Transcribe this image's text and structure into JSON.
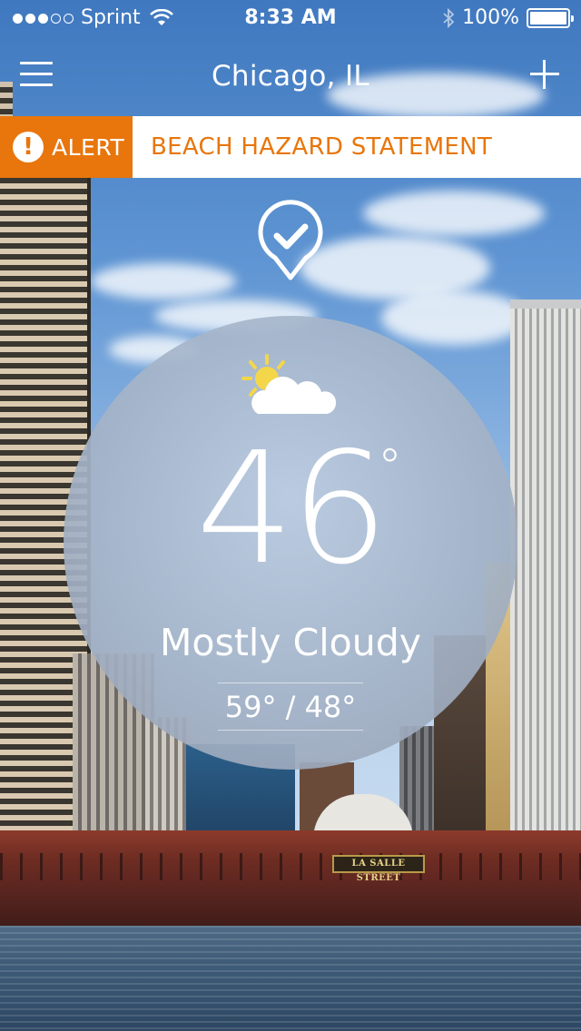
{
  "status_bar": {
    "carrier": "Sprint",
    "signal_bars_filled": 3,
    "signal_bars_total": 5,
    "time": "8:33 AM",
    "battery": "100%"
  },
  "nav": {
    "title": "Chicago, IL"
  },
  "alert": {
    "label": "ALERT",
    "icon_glyph": "!",
    "text": "BEACH HAZARD STATEMENT",
    "color": "#e8760c"
  },
  "weather": {
    "temperature": "46",
    "degree_symbol": "°",
    "condition": "Mostly Cloudy",
    "high_low": "59° / 48°",
    "condition_icon": "partly-sunny-icon"
  },
  "background": {
    "sign_text": "LA SALLE STREET"
  }
}
